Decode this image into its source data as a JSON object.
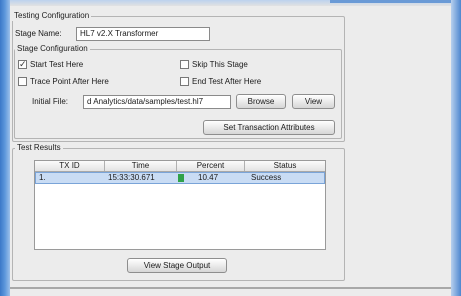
{
  "testing_config": {
    "title": "Testing Configuration",
    "stage_name_label": "Stage Name:",
    "stage_name_value": "HL7 v2.X Transformer"
  },
  "stage_config": {
    "title": "Stage Configuration",
    "start_test_here": {
      "label": "Start Test Here",
      "checked": true
    },
    "skip_this_stage": {
      "label": "Skip This Stage",
      "checked": false
    },
    "trace_point_after_here": {
      "label": "Trace Point After Here",
      "checked": false
    },
    "end_test_after_here": {
      "label": "End Test After Here",
      "checked": false
    },
    "initial_file_label": "Initial File:",
    "initial_file_value": "d Analytics/data/samples/test.hl7",
    "browse_label": "Browse",
    "view_label": "View",
    "set_transaction_label": "Set Transaction Attributes"
  },
  "test_results": {
    "title": "Test Results",
    "columns": [
      "TX ID",
      "Time",
      "Percent",
      "Status"
    ],
    "rows": [
      {
        "tx_id": "1.",
        "time": "15:33:30.671",
        "percent": "10.47",
        "status": "Success"
      }
    ],
    "view_stage_output_label": "View Stage Output"
  },
  "colors": {
    "selection": "#c9dcf4",
    "progress": "#2fa24a",
    "window_accent": "#3a78c8"
  }
}
